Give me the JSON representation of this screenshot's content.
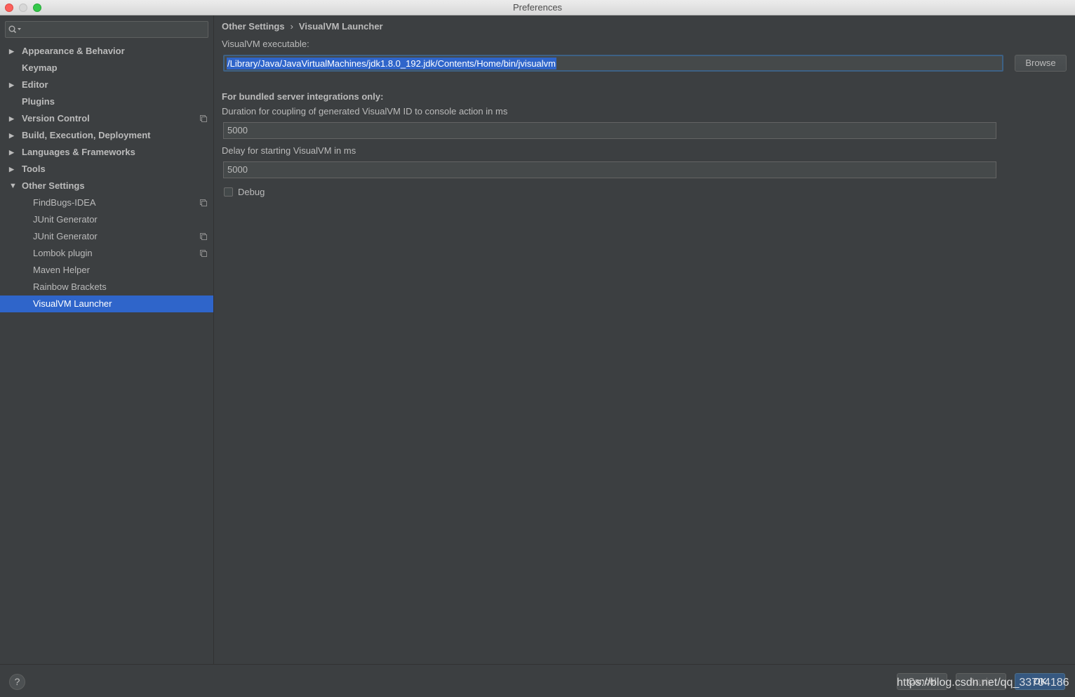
{
  "window": {
    "title": "Preferences"
  },
  "sidebar": {
    "search_placeholder": "",
    "items": [
      {
        "label": "Appearance & Behavior",
        "expandable": true
      },
      {
        "label": "Keymap"
      },
      {
        "label": "Editor",
        "expandable": true
      },
      {
        "label": "Plugins"
      },
      {
        "label": "Version Control",
        "expandable": true
      },
      {
        "label": "Build, Execution, Deployment",
        "expandable": true
      },
      {
        "label": "Languages & Frameworks",
        "expandable": true
      },
      {
        "label": "Tools",
        "expandable": true
      },
      {
        "label": "Other Settings",
        "expanded": true
      },
      {
        "label": "FindBugs-IDEA"
      },
      {
        "label": "JUnit Generator"
      },
      {
        "label": "JUnit Generator"
      },
      {
        "label": "Lombok plugin"
      },
      {
        "label": "Maven Helper"
      },
      {
        "label": "Rainbow Brackets"
      },
      {
        "label": "VisualVM Launcher",
        "selected": true
      }
    ]
  },
  "content": {
    "breadcrumb": {
      "parent": "Other Settings",
      "separator": "›",
      "current": "VisualVM Launcher"
    },
    "executable_label": "VisualVM executable:",
    "executable_value": "/Library/Java/JavaVirtualMachines/jdk1.8.0_192.jdk/Contents/Home/bin/jvisualvm",
    "browse_label": "Browse",
    "bundled_heading": "For bundled server integrations only:",
    "duration_label": "Duration for coupling of generated VisualVM ID to console action in ms",
    "duration_value": "5000",
    "delay_label": "Delay for starting VisualVM in ms",
    "delay_value": "5000",
    "debug_label": "Debug",
    "debug_checked": false
  },
  "footer": {
    "help_label": "?",
    "cancel_label": "Cancel",
    "apply_label": "Apply",
    "ok_label": "OK",
    "watermark": "https://blog.csdn.net/qq_33704186"
  },
  "colors": {
    "background": "#3c3f41",
    "selection": "#2f65ca",
    "text": "#bbbbbb",
    "ok_button": "#365880"
  }
}
